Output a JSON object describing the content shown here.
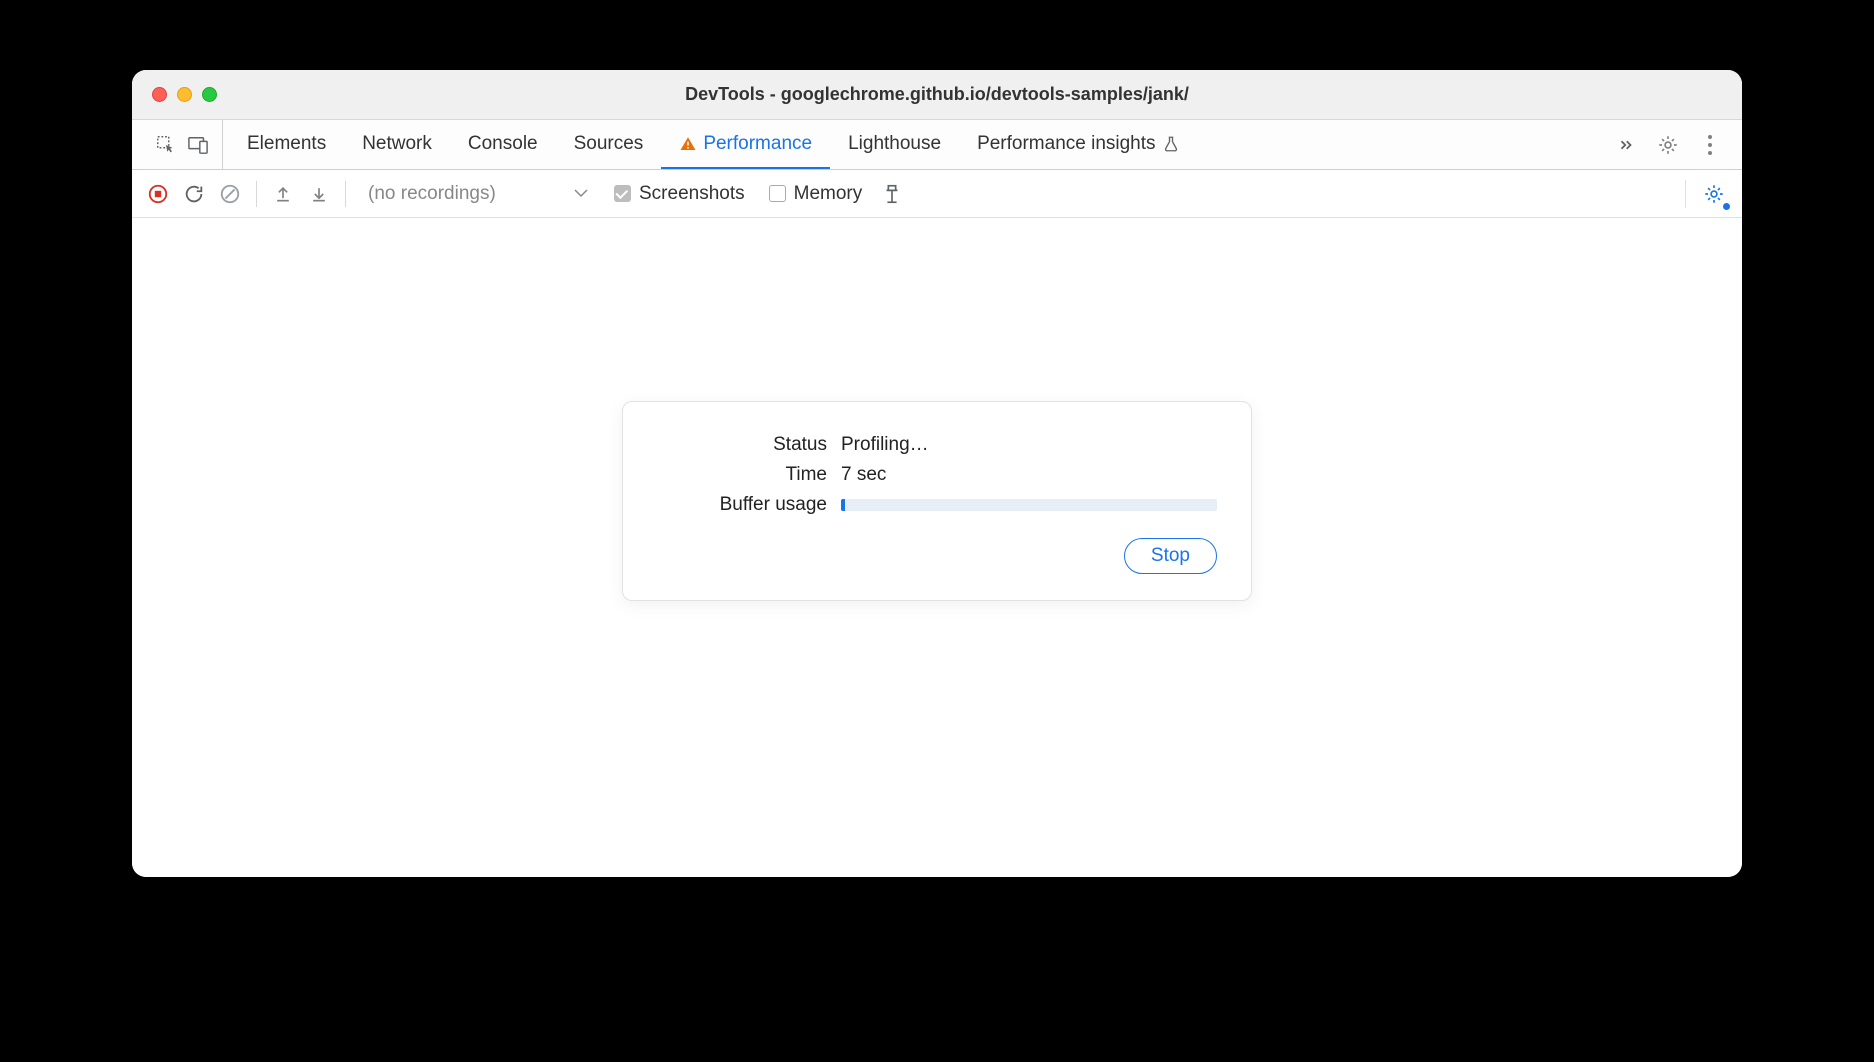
{
  "window": {
    "title": "DevTools - googlechrome.github.io/devtools-samples/jank/"
  },
  "tabs": {
    "items": [
      {
        "label": "Elements"
      },
      {
        "label": "Network"
      },
      {
        "label": "Console"
      },
      {
        "label": "Sources"
      },
      {
        "label": "Performance"
      },
      {
        "label": "Lighthouse"
      },
      {
        "label": "Performance insights"
      }
    ],
    "activeIndex": 4
  },
  "toolbar": {
    "recordings_placeholder": "(no recordings)",
    "screenshots_label": "Screenshots",
    "memory_label": "Memory",
    "screenshots_checked": true,
    "memory_checked": false
  },
  "dialog": {
    "status_label": "Status",
    "status_value": "Profiling…",
    "time_label": "Time",
    "time_value": "7 sec",
    "buffer_label": "Buffer usage",
    "buffer_percent": 1,
    "stop_label": "Stop"
  }
}
